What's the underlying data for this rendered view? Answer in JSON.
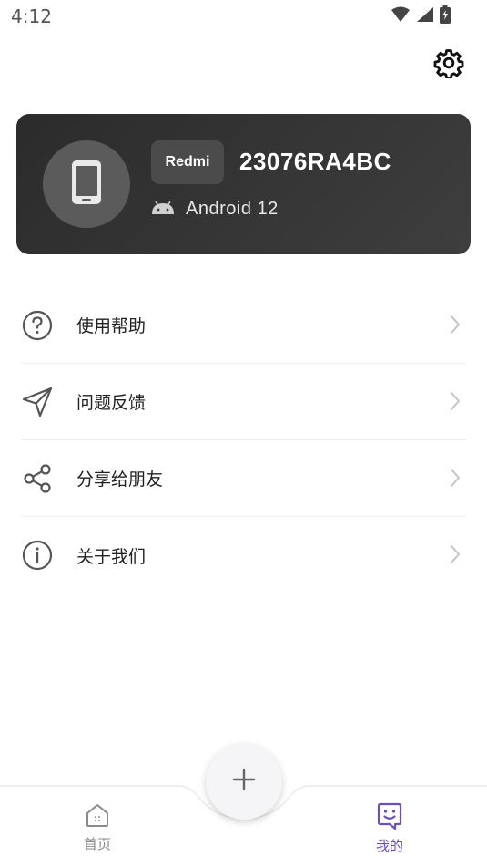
{
  "status_bar": {
    "time": "4:12"
  },
  "device": {
    "brand": "Redmi",
    "model": "23076RA4BC",
    "android_version": "Android 12"
  },
  "menu": {
    "items": [
      {
        "label": "使用帮助",
        "icon": "help-circle-icon"
      },
      {
        "label": "问题反馈",
        "icon": "send-icon"
      },
      {
        "label": "分享给朋友",
        "icon": "share-icon"
      },
      {
        "label": "关于我们",
        "icon": "info-circle-icon"
      }
    ]
  },
  "bottom_nav": {
    "tabs": [
      {
        "label": "首页",
        "icon": "home-icon",
        "active": false
      },
      {
        "label": "我的",
        "icon": "profile-face-icon",
        "active": true
      }
    ],
    "fab_icon": "plus-icon"
  },
  "colors": {
    "accent": "#6b4fbf",
    "card_bg": "#333333",
    "inactive": "#8a8a8a"
  }
}
